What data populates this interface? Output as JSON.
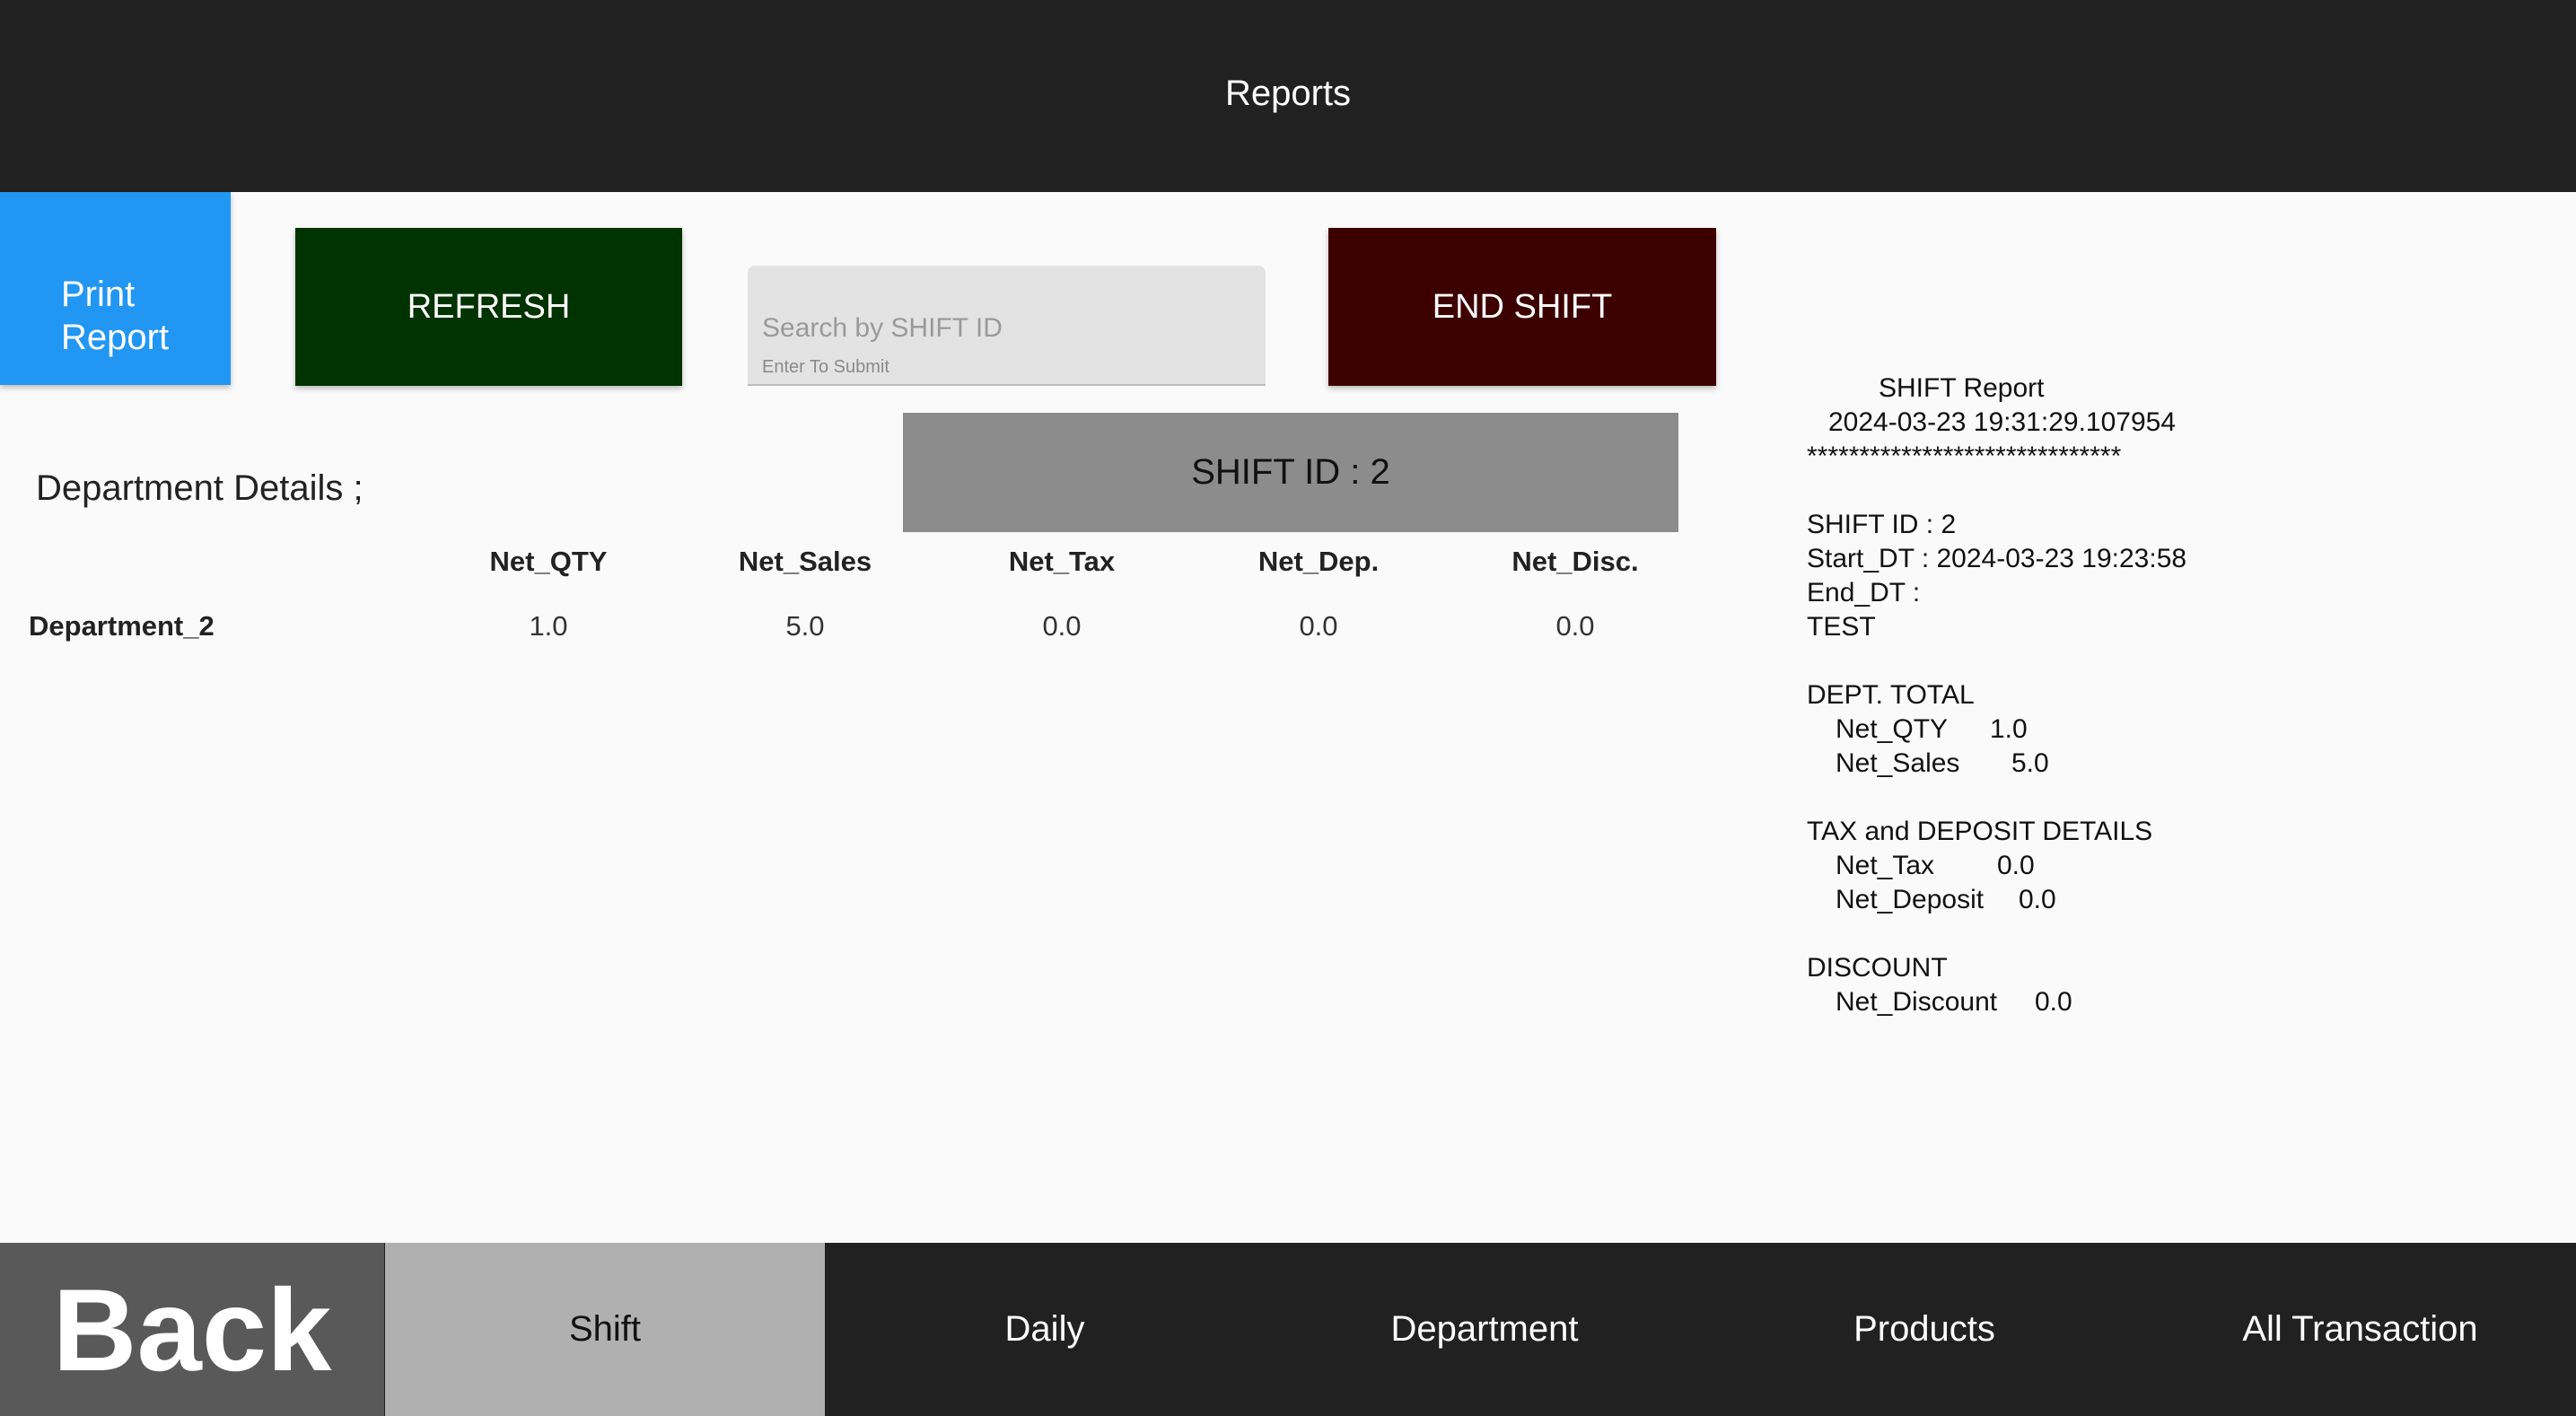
{
  "header": {
    "title": "Reports"
  },
  "toolbar": {
    "print_label_line1": "Print",
    "print_label_line2": "Report",
    "refresh_label": "REFRESH",
    "search_placeholder": "Search by SHIFT ID",
    "search_value": "",
    "search_hint": "Enter To Submit",
    "end_shift_label": "END SHIFT",
    "colors": {
      "print": "#2196f3",
      "refresh": "#003300",
      "end_shift": "#3d0000"
    }
  },
  "shift_banner": {
    "text": "SHIFT ID : 2"
  },
  "department": {
    "heading": "Department Details ;",
    "columns": [
      "Net_QTY",
      "Net_Sales",
      "Net_Tax",
      "Net_Dep.",
      "Net_Disc."
    ],
    "rows": [
      {
        "name": "Department_2",
        "values": [
          "1.0",
          "5.0",
          "0.0",
          "0.0",
          "0.0"
        ]
      }
    ]
  },
  "report": {
    "title": "SHIFT Report",
    "timestamp": "2024-03-23 19:31:29.107954",
    "separator": "******************************",
    "shift_id": "SHIFT ID : 2",
    "start_dt": "Start_DT : 2024-03-23 19:23:58",
    "end_dt": "End_DT :",
    "user": "TEST",
    "dept_total_heading": "DEPT. TOTAL",
    "net_qty_label": "Net_QTY",
    "net_qty_value": "1.0",
    "net_sales_label": "Net_Sales",
    "net_sales_value": "5.0",
    "tax_heading": "TAX and DEPOSIT DETAILS",
    "net_tax_label": "Net_Tax",
    "net_tax_value": "0.0",
    "net_deposit_label": "Net_Deposit",
    "net_deposit_value": "0.0",
    "discount_heading": "DISCOUNT",
    "net_discount_label": "Net_Discount",
    "net_discount_value": "0.0"
  },
  "nav": {
    "back_label": "Back",
    "tabs": [
      {
        "label": "Shift",
        "active": true
      },
      {
        "label": "Daily",
        "active": false
      },
      {
        "label": "Department",
        "active": false
      },
      {
        "label": "Products",
        "active": false
      },
      {
        "label": "All Transaction",
        "active": false
      }
    ]
  }
}
